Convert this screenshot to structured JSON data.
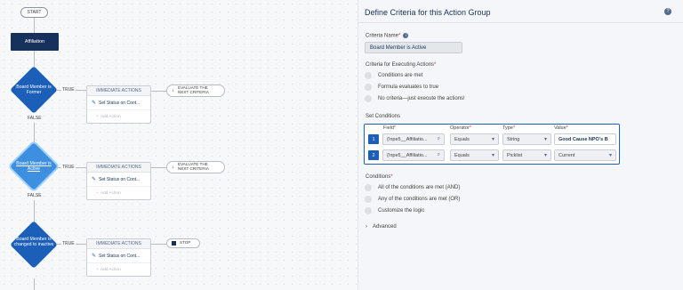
{
  "flow": {
    "start": "START",
    "object": "Affiliation",
    "nodes": [
      {
        "label": "Board Member is Former",
        "true_label": "TRUE",
        "false_label": "FALSE",
        "header": "IMMEDIATE ACTIONS",
        "action": "Set Status on Cont...",
        "add": "Add Action",
        "next": "EVALUATE THE NEXT CRITERIA"
      },
      {
        "label": "Board Member is Active",
        "true_label": "TRUE",
        "false_label": "FALSE",
        "header": "IMMEDIATE ACTIONS",
        "action": "Set Status on Cont...",
        "add": "Add Action",
        "next": "EVALUATE THE NEXT CRITERIA"
      },
      {
        "label": "Board Member is changed to inactive",
        "true_label": "TRUE",
        "header": "IMMEDIATE ACTIONS",
        "action": "Set Status on Cont...",
        "add": "Add Action",
        "next": "STOP"
      }
    ]
  },
  "panel": {
    "title": "Define Criteria for this Action Group",
    "criteria_name_label": "Criteria Name",
    "criteria_name_value": "Board Member is Active",
    "executing_label": "Criteria for Executing Actions",
    "executing_options": [
      "Conditions are met",
      "Formula evaluates to true",
      "No criteria—just execute the actions!"
    ],
    "set_conditions_label": "Set Conditions",
    "columns": {
      "field": "Field",
      "operator": "Operator",
      "type": "Type",
      "value": "Value"
    },
    "rows": [
      {
        "num": "1",
        "field": "{!npe5__Affiliatio...",
        "operator": "Equals",
        "type": "String",
        "value": "Good Cause NPO's B"
      },
      {
        "num": "2",
        "field": "{!npe5__Affiliatio...",
        "operator": "Equals",
        "type": "Picklist",
        "value": "Current"
      }
    ],
    "conditions_label": "Conditions",
    "conditions_options": [
      "All of the conditions are met (AND)",
      "Any of the conditions are met (OR)",
      "Customize the logic"
    ],
    "advanced_label": "Advanced",
    "required_mark": "*"
  }
}
